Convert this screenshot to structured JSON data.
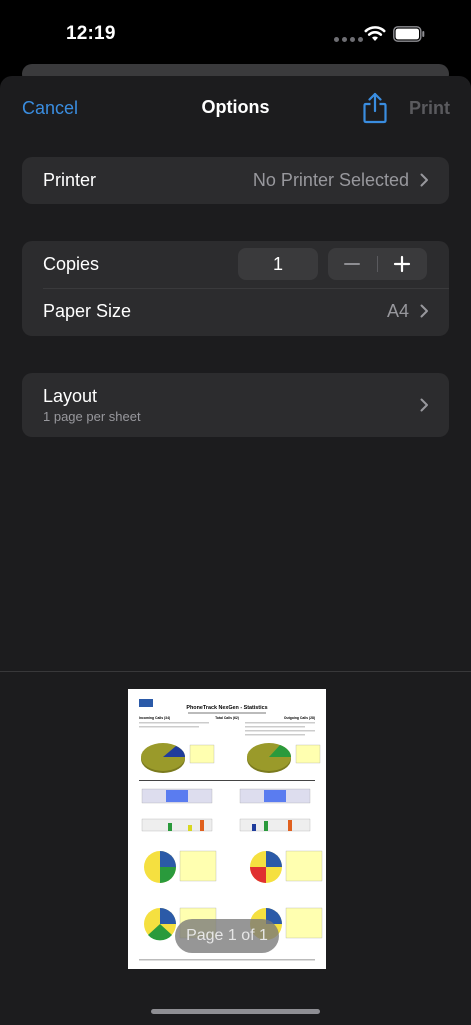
{
  "status": {
    "time": "12:19"
  },
  "nav": {
    "cancel": "Cancel",
    "title": "Options",
    "print": "Print"
  },
  "printer": {
    "label": "Printer",
    "value": "No Printer Selected"
  },
  "copies": {
    "label": "Copies",
    "value": "1"
  },
  "paper": {
    "label": "Paper Size",
    "value": "A4"
  },
  "layout": {
    "label": "Layout",
    "sub": "1 page per sheet"
  },
  "preview": {
    "pill": "Page 1 of 1",
    "doc_title": "PhoneTrack NexGen - Statistics",
    "col_incoming": "Incoming Calls (34)",
    "col_total": "Total Calls (62)",
    "col_outgoing": "Outgoing Calls (28)"
  },
  "colors": {
    "accent": "#3a8de0",
    "background": "#1c1c1e",
    "cell": "#2c2c2e"
  }
}
